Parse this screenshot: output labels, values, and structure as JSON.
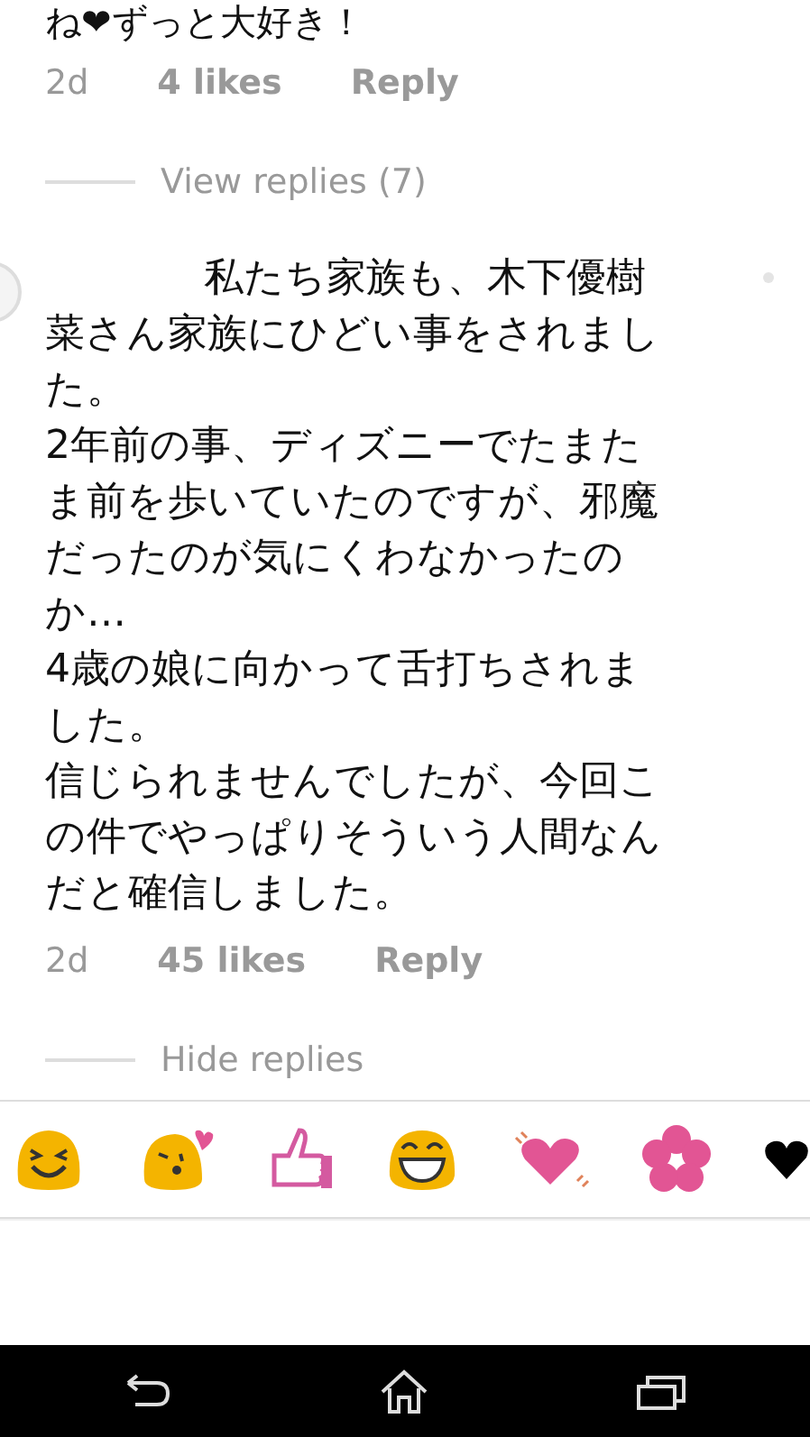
{
  "comments": [
    {
      "paragraphs": [
        "ね❤ずっと大好き！"
      ],
      "time": "2d",
      "likes": "4 likes",
      "reply": "Reply",
      "replies_toggle": "View replies (7)"
    },
    {
      "paragraphs": [
        "私たち家族も、木下優樹菜さん家族にひどい事をされました。",
        "2年前の事、ディズニーでたまたま前を歩いていたのですが、邪魔だったのが気にくわなかったのか…",
        "4歳の娘に向かって舌打ちされました。",
        "信じられませんでしたが、今回この件でやっぱりそういう人間なんだと確信しました。"
      ],
      "time": "2d",
      "likes": "45 likes",
      "reply": "Reply",
      "replies_toggle": "Hide replies"
    }
  ]
}
